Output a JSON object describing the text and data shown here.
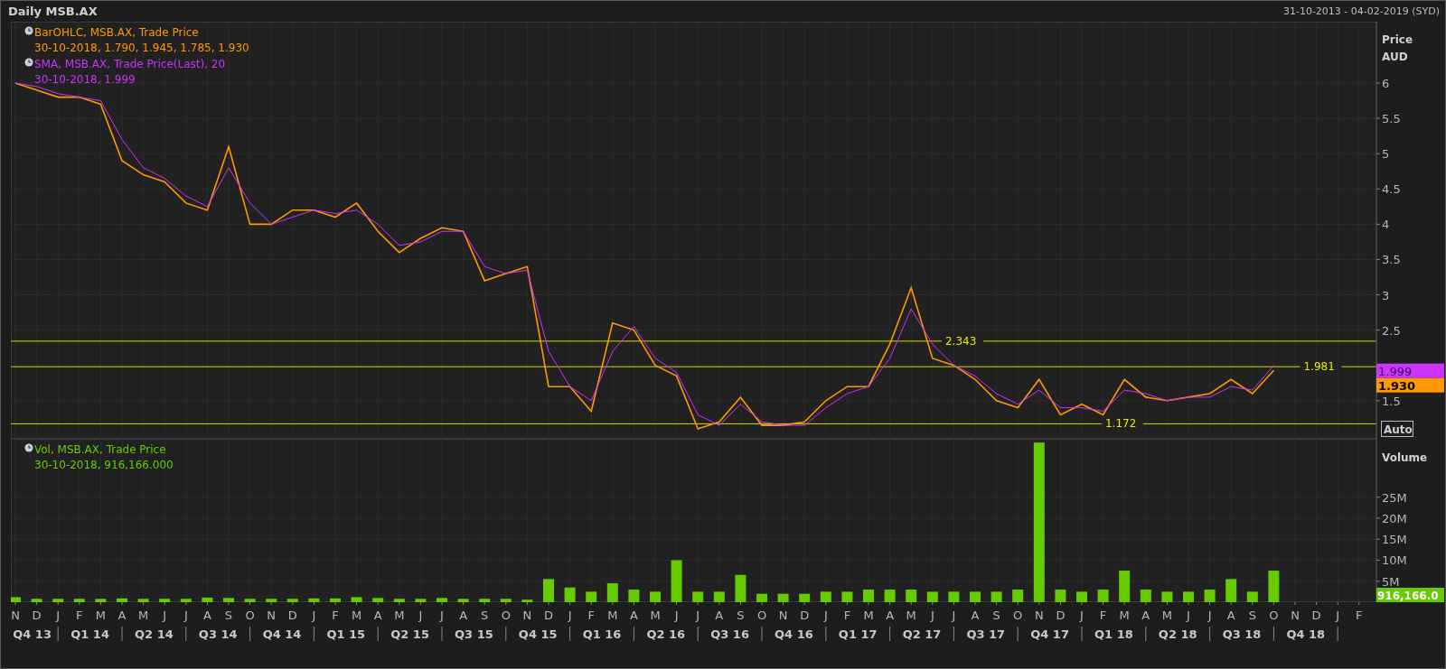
{
  "window": {
    "title": "Daily MSB.AX",
    "date_range": "31-10-2013 - 04-02-2019 (SYD)"
  },
  "price_panel": {
    "legend": [
      {
        "values": "30-10-2018, 1.790, 1.945, 1.785, 1.930"
      },
      {
        "values": "30-10-2018, 1.999"
      }
    ],
    "axis_title": "Price",
    "axis_unit": "AUD",
    "scale_button": "Auto",
    "last_value_tags": [
      {
        "label": "1.999",
        "kind": "average"
      },
      {
        "label": "1.930",
        "kind": "price"
      }
    ],
    "chart_data": {
      "type": "line",
      "grid": true,
      "ylim": [
        0.96,
        6.87
      ],
      "yticks": [
        1.5,
        2.5,
        3,
        3.5,
        4,
        4.5,
        5,
        5.5,
        6
      ],
      "series": [
        {
          "name": "BarOHLC, MSB.AX, Trade Price",
          "color": "#ff9900",
          "values": [
            6.0,
            5.9,
            5.8,
            5.8,
            5.7,
            4.9,
            4.7,
            4.6,
            4.3,
            4.2,
            5.1,
            4.0,
            4.0,
            4.2,
            4.2,
            4.1,
            4.3,
            3.9,
            3.6,
            3.8,
            3.95,
            3.9,
            3.2,
            3.3,
            3.4,
            1.7,
            1.7,
            1.35,
            2.6,
            2.5,
            2.0,
            1.85,
            1.1,
            1.2,
            1.55,
            1.15,
            1.15,
            1.2,
            1.5,
            1.7,
            1.7,
            2.3,
            3.1,
            2.1,
            2.0,
            1.8,
            1.5,
            1.4,
            1.8,
            1.3,
            1.45,
            1.3,
            1.8,
            1.55,
            1.5,
            1.55,
            1.6,
            1.8,
            1.6,
            1.93,
            null,
            null,
            null,
            null
          ]
        },
        {
          "name": "SMA, MSB.AX, Trade Price(Last),  20",
          "color": "#cc33ff",
          "values": [
            6.0,
            5.95,
            5.85,
            5.8,
            5.75,
            5.2,
            4.8,
            4.65,
            4.4,
            4.25,
            4.8,
            4.3,
            4.0,
            4.1,
            4.2,
            4.15,
            4.2,
            4.0,
            3.7,
            3.75,
            3.9,
            3.9,
            3.4,
            3.3,
            3.35,
            2.2,
            1.7,
            1.5,
            2.2,
            2.55,
            2.1,
            1.9,
            1.3,
            1.15,
            1.45,
            1.2,
            1.15,
            1.15,
            1.4,
            1.6,
            1.7,
            2.1,
            2.8,
            2.3,
            2.0,
            1.85,
            1.6,
            1.45,
            1.65,
            1.4,
            1.4,
            1.35,
            1.65,
            1.6,
            1.5,
            1.55,
            1.55,
            1.7,
            1.65,
            2.0,
            null,
            null,
            null,
            null
          ]
        }
      ],
      "ref_lines": [
        {
          "axis": "y",
          "value": 2.343,
          "label": "2.343"
        },
        {
          "axis": "y",
          "value": 1.981,
          "label": "1.981"
        },
        {
          "axis": "y",
          "value": 1.172,
          "label": "1.172"
        }
      ]
    }
  },
  "volume_panel": {
    "legend": [
      {
        "values": "30-10-2018, 916,166.000"
      }
    ],
    "axis_title": "Volume",
    "last_value_tag": "916,166.0",
    "chart_data": {
      "type": "bar",
      "grid": true,
      "ylim": [
        0,
        38.9
      ],
      "yticks": [
        {
          "value": 5,
          "label": "5M"
        },
        {
          "value": 10,
          "label": "10M"
        },
        {
          "value": 15,
          "label": "15M"
        },
        {
          "value": 20,
          "label": "20M"
        },
        {
          "value": 25,
          "label": "25M"
        }
      ],
      "categories": [
        "N",
        "D",
        "J",
        "F",
        "M",
        "A",
        "M",
        "J",
        "J",
        "A",
        "S",
        "O",
        "N",
        "D",
        "J",
        "F",
        "M",
        "A",
        "M",
        "J",
        "J",
        "A",
        "S",
        "O",
        "N",
        "D",
        "J",
        "F",
        "M",
        "A",
        "M",
        "J",
        "J",
        "A",
        "S",
        "O",
        "N",
        "D",
        "J",
        "F",
        "M",
        "A",
        "M",
        "J",
        "J",
        "A",
        "S",
        "O",
        "N",
        "D",
        "J",
        "F",
        "M",
        "A",
        "M",
        "J",
        "J",
        "A",
        "S",
        "O",
        "N",
        "D",
        "J",
        "F"
      ],
      "series": [
        {
          "name": "Vol, MSB.AX, Trade Price",
          "color": "#66cc00",
          "values": [
            1.2,
            0.8,
            0.8,
            0.8,
            0.8,
            0.9,
            0.8,
            0.8,
            0.8,
            1.1,
            1.0,
            0.8,
            0.8,
            0.8,
            0.9,
            0.9,
            1.2,
            1.0,
            0.8,
            0.8,
            1.0,
            0.8,
            0.8,
            0.8,
            0.6,
            5.5,
            3.5,
            2.5,
            4.5,
            3.0,
            2.5,
            10.0,
            2.5,
            2.5,
            6.5,
            2.0,
            2.0,
            2.0,
            2.5,
            2.5,
            3.0,
            3.0,
            3.0,
            2.5,
            2.5,
            2.5,
            2.5,
            3.0,
            38.0,
            3.0,
            2.5,
            3.0,
            7.5,
            3.0,
            2.5,
            2.5,
            3.0,
            5.5,
            2.5,
            7.5,
            null,
            null,
            null,
            null
          ]
        }
      ]
    }
  },
  "time_axis": {
    "quarters": [
      "Q4 13",
      "Q1 14",
      "Q2 14",
      "Q3 14",
      "Q4 14",
      "Q1 15",
      "Q2 15",
      "Q3 15",
      "Q4 15",
      "Q1 16",
      "Q2 16",
      "Q3 16",
      "Q4 16",
      "Q1 17",
      "Q2 17",
      "Q3 17",
      "Q4 17",
      "Q1 18",
      "Q2 18",
      "Q3 18",
      "Q4 18"
    ]
  }
}
